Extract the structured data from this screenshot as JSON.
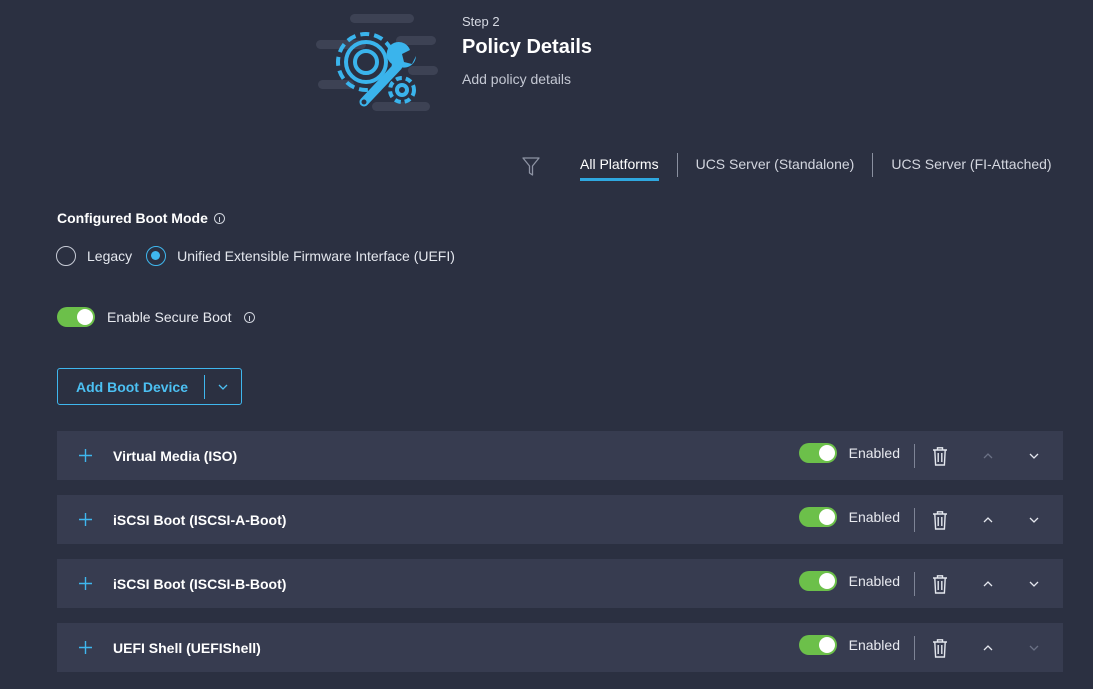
{
  "header": {
    "step_label": "Step 2",
    "title": "Policy Details",
    "subtitle": "Add policy details",
    "illustration_icon": "gear-wrench-icon"
  },
  "platform_filter": {
    "icon": "filter-icon",
    "tabs": [
      {
        "label": "All Platforms",
        "active": true
      },
      {
        "label": "UCS Server (Standalone)",
        "active": false
      },
      {
        "label": "UCS Server (FI-Attached)",
        "active": false
      }
    ]
  },
  "boot_mode": {
    "label": "Configured Boot Mode",
    "options": [
      {
        "label": "Legacy",
        "selected": false
      },
      {
        "label": "Unified Extensible Firmware Interface (UEFI)",
        "selected": true
      }
    ]
  },
  "secure_boot": {
    "label": "Enable Secure Boot",
    "enabled": true
  },
  "add_boot_device": {
    "label": "Add Boot Device"
  },
  "boot_devices": [
    {
      "name": "Virtual Media (ISO)",
      "status": "Enabled",
      "enabled": true,
      "up_disabled": true,
      "down_disabled": false
    },
    {
      "name": "iSCSI Boot (ISCSI-A-Boot)",
      "status": "Enabled",
      "enabled": true,
      "up_disabled": false,
      "down_disabled": false
    },
    {
      "name": "iSCSI Boot (ISCSI-B-Boot)",
      "status": "Enabled",
      "enabled": true,
      "up_disabled": false,
      "down_disabled": false
    },
    {
      "name": "UEFI Shell (UEFIShell)",
      "status": "Enabled",
      "enabled": true,
      "up_disabled": false,
      "down_disabled": true
    }
  ],
  "colors": {
    "background": "#2b3041",
    "row_background": "#373c50",
    "accent": "#3fb7ee",
    "toggle_on": "#6cc04a"
  }
}
